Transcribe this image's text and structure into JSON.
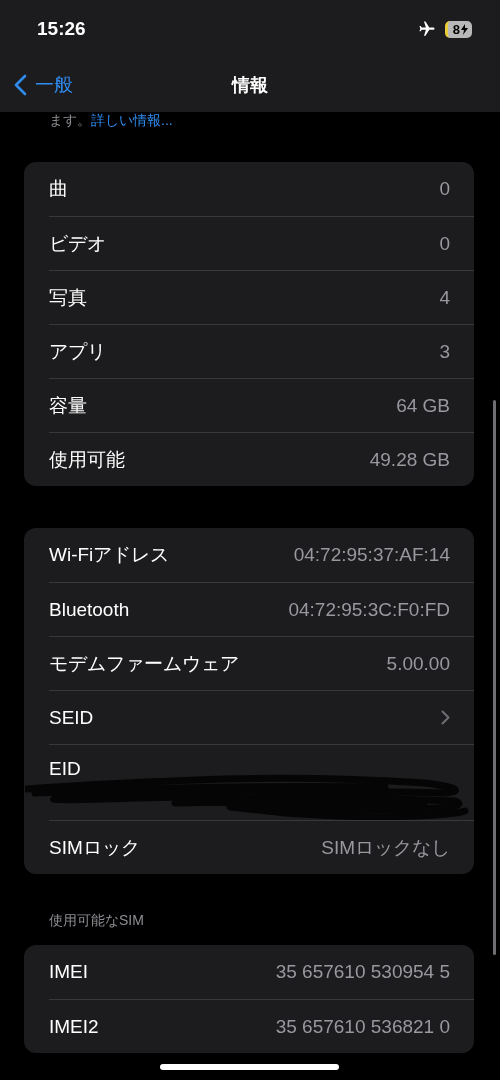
{
  "status_bar": {
    "time": "15:26",
    "battery": "8"
  },
  "nav": {
    "back": "一般",
    "title": "情報"
  },
  "intro": {
    "text": "ます。",
    "link": "詳しい情報..."
  },
  "groups": [
    {
      "rows": [
        {
          "kind": "value",
          "label": "曲",
          "value": "0"
        },
        {
          "kind": "value",
          "label": "ビデオ",
          "value": "0"
        },
        {
          "kind": "value",
          "label": "写真",
          "value": "4"
        },
        {
          "kind": "value",
          "label": "アプリ",
          "value": "3"
        },
        {
          "kind": "value",
          "label": "容量",
          "value": "64 GB"
        },
        {
          "kind": "value",
          "label": "使用可能",
          "value": "49.28 GB"
        }
      ]
    },
    {
      "rows": [
        {
          "kind": "value",
          "label": "Wi-Fiアドレス",
          "value": "04:72:95:37:AF:14"
        },
        {
          "kind": "value",
          "label": "Bluetooth",
          "value": "04:72:95:3C:F0:FD"
        },
        {
          "kind": "value",
          "label": "モデムファームウェア",
          "value": "5.00.00"
        },
        {
          "kind": "chevron",
          "label": "SEID"
        },
        {
          "kind": "redacted",
          "label": "EID"
        },
        {
          "kind": "value",
          "label": "SIMロック",
          "value": "SIMロックなし"
        }
      ]
    },
    {
      "header": "使用可能なSIM",
      "rows": [
        {
          "kind": "value",
          "label": "IMEI",
          "value": "35 657610 530954 5"
        },
        {
          "kind": "value",
          "label": "IMEI2",
          "value": "35 657610 536821 0"
        }
      ]
    }
  ]
}
